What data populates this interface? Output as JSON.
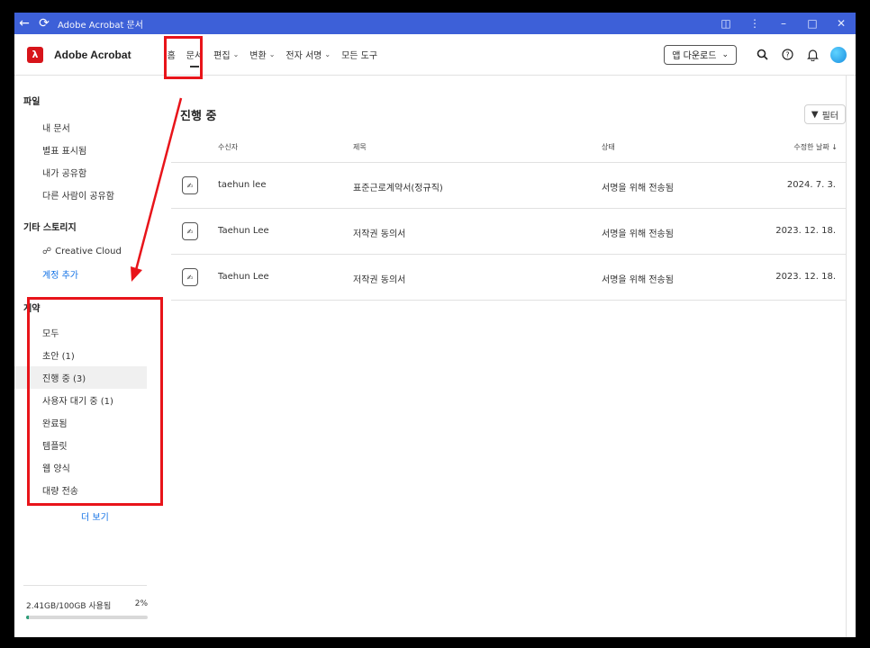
{
  "window": {
    "title": "Adobe Acrobat 문서"
  },
  "brand": {
    "name": "Adobe Acrobat"
  },
  "nav": [
    {
      "label": "홈",
      "dropdown": false,
      "active": false
    },
    {
      "label": "문서",
      "dropdown": false,
      "active": true
    },
    {
      "label": "편집",
      "dropdown": true,
      "active": false
    },
    {
      "label": "변환",
      "dropdown": true,
      "active": false
    },
    {
      "label": "전자 서명",
      "dropdown": true,
      "active": false
    },
    {
      "label": "모든 도구",
      "dropdown": false,
      "active": false
    }
  ],
  "header": {
    "download_label": "앱 다운로드"
  },
  "sidebar": {
    "files_title": "파일",
    "files": [
      "내 문서",
      "별표 표시됨",
      "내가 공유함",
      "다른 사람이 공유함"
    ],
    "storage_title": "기타 스토리지",
    "creative_cloud": "Creative Cloud",
    "add_account": "계정 추가",
    "agreements_title": "계약",
    "agreements": [
      "모두",
      "초안 (1)",
      "진행 중 (3)",
      "사용자 대기 중 (1)",
      "완료됨",
      "템플릿",
      "웹 양식",
      "대량 전송"
    ],
    "more_label": "더 보기",
    "storage_usage": "2.41GB/100GB 사용됨",
    "storage_percent": "2%",
    "storage_fraction": 0.02
  },
  "main": {
    "title": "진행 중",
    "filter_label": "필터",
    "columns": {
      "recipient": "수신자",
      "title": "제목",
      "status": "상태",
      "modified": "수정한 날짜"
    },
    "rows": [
      {
        "recipient": "taehun lee",
        "title": "표준근로계약서(정규직)",
        "status": "서명을 위해 전송됨",
        "date": "2024. 7. 3."
      },
      {
        "recipient": "Taehun Lee",
        "title": "저작권 동의서",
        "status": "서명을 위해 전송됨",
        "date": "2023. 12. 18."
      },
      {
        "recipient": "Taehun Lee",
        "title": "저작권 동의서",
        "status": "서명을 위해 전송됨",
        "date": "2023. 12. 18."
      }
    ]
  },
  "colors": {
    "accent": "#1473e6",
    "annotation": "#e8141a",
    "titlebar": "#3d60d8",
    "brand_red": "#d7141a"
  }
}
